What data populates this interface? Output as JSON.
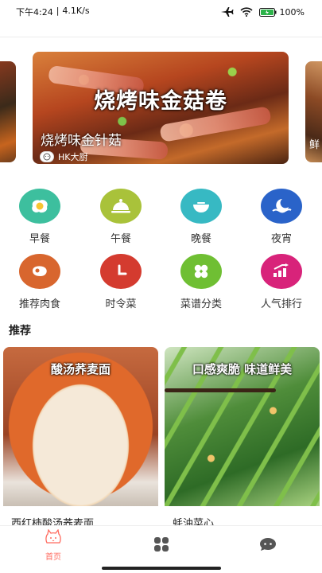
{
  "status_bar": {
    "time": "下午4:24",
    "separator": "|",
    "network_speed": "4.1K/s",
    "battery": "100%"
  },
  "banner": {
    "title": "烧烤味金菇卷",
    "caption": "烧烤味金针菇",
    "author": "HK大厨",
    "next_peek_text": "鲜"
  },
  "categories": [
    {
      "label": "早餐",
      "icon": "fried-egg-icon",
      "color": "#3dbf9e"
    },
    {
      "label": "午餐",
      "icon": "cloche-icon",
      "color": "#a9c23a"
    },
    {
      "label": "晚餐",
      "icon": "bowl-icon",
      "color": "#37b9c3"
    },
    {
      "label": "夜宵",
      "icon": "moon-wave-icon",
      "color": "#2a63c9"
    },
    {
      "label": "推荐肉食",
      "icon": "steak-icon",
      "color": "#d8662e"
    },
    {
      "label": "时令菜",
      "icon": "clock-icon",
      "color": "#d43b2f"
    },
    {
      "label": "菜谱分类",
      "icon": "four-leaf-icon",
      "color": "#6fbf33"
    },
    {
      "label": "人气排行",
      "icon": "ranking-icon",
      "color": "#d8237a"
    }
  ],
  "section": {
    "title": "推荐"
  },
  "recipes": [
    {
      "overlay": "酸汤荞麦面",
      "name": "西红柿酸汤荞麦面"
    },
    {
      "overlay": "口感爽脆 味道鲜美",
      "name": "蚝油菜心"
    }
  ],
  "tabbar": {
    "home_label": "首页",
    "active_color": "#ff6b5f",
    "inactive_color": "#555555"
  }
}
